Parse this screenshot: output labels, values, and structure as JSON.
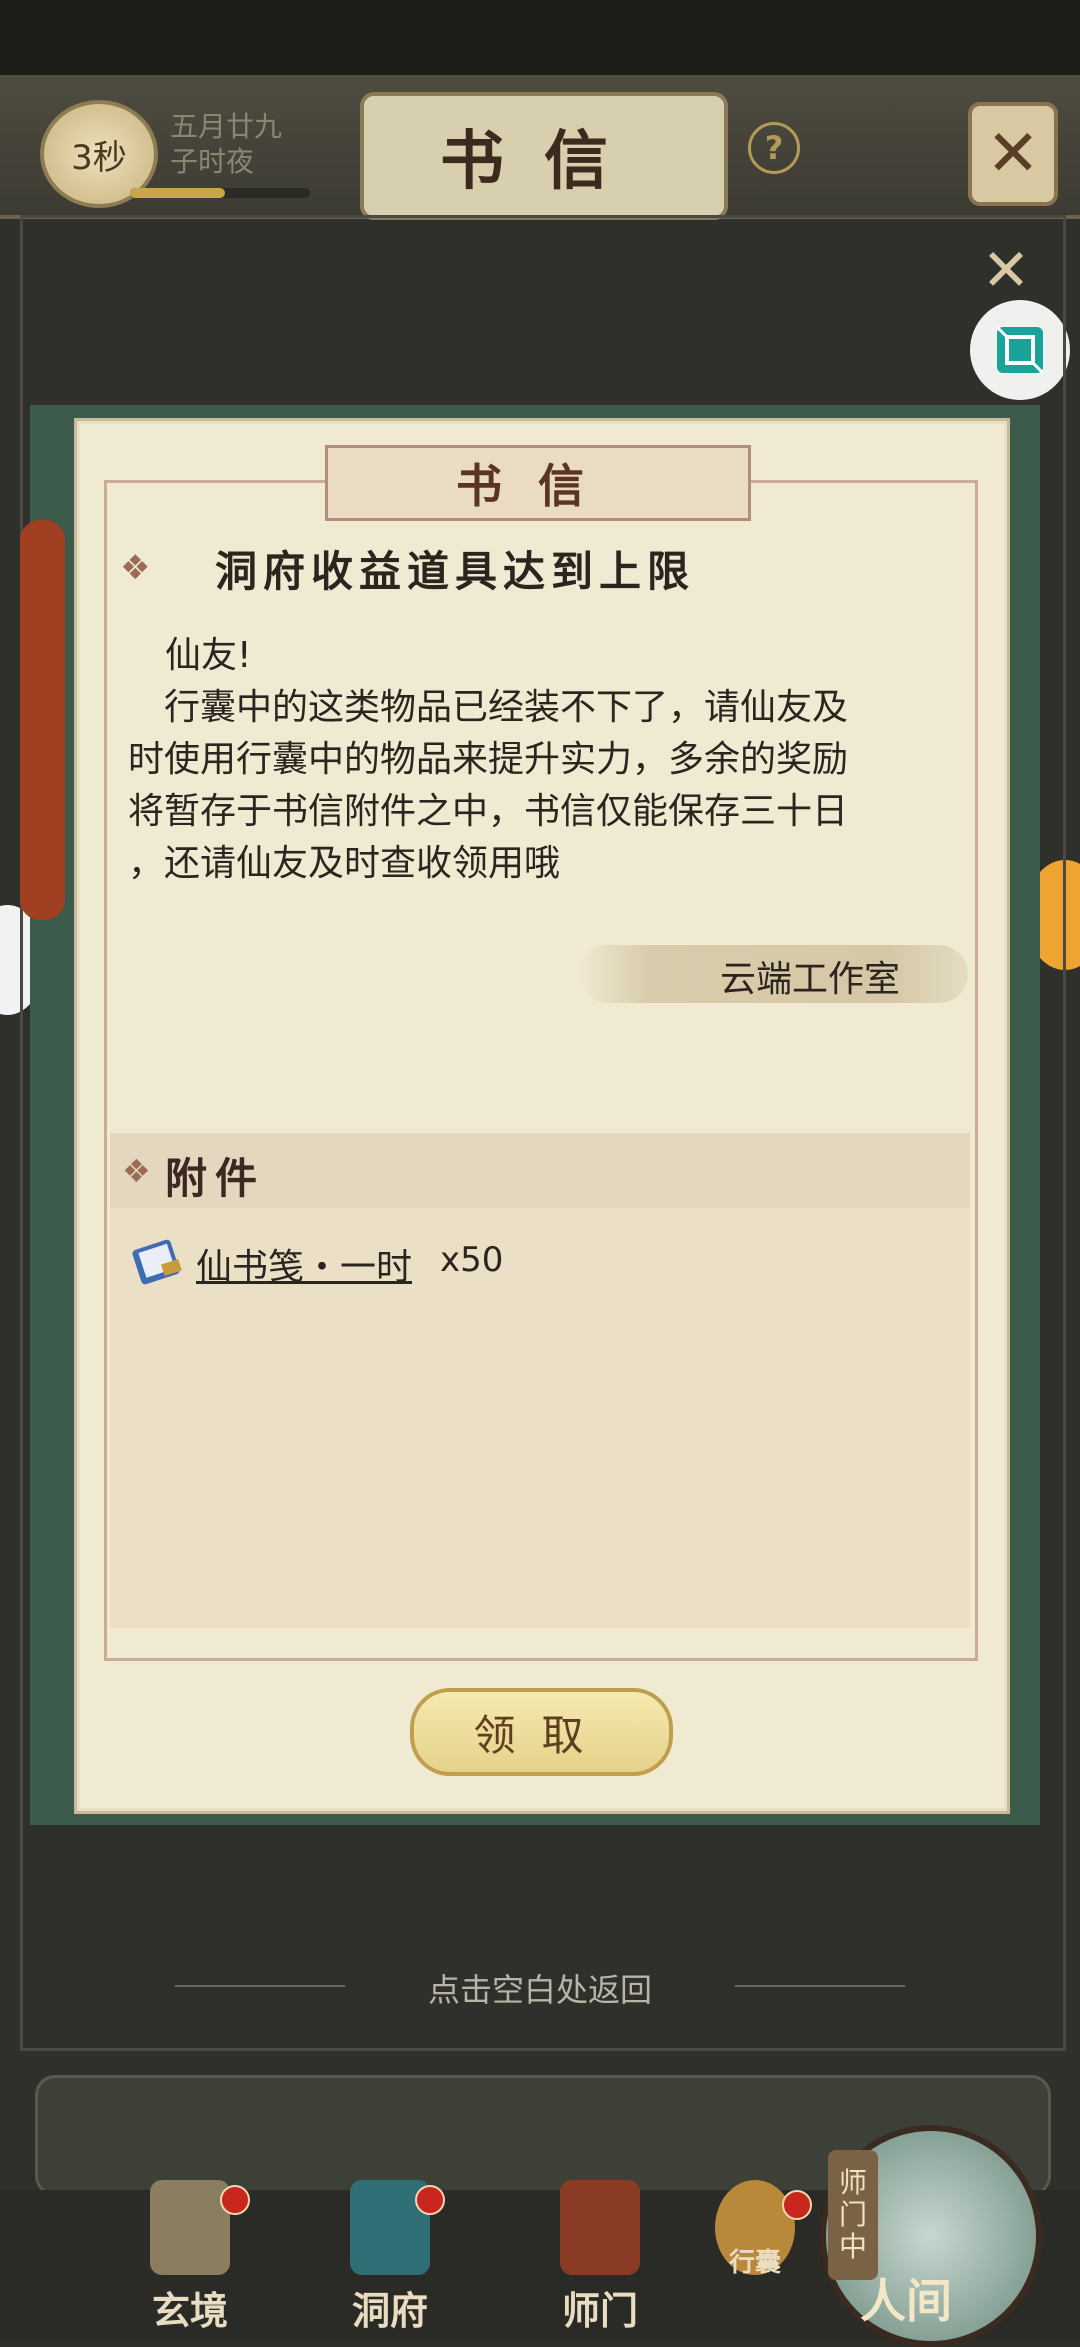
{
  "top_bar": {
    "timer": "3秒",
    "date_line1": "五月廿九",
    "date_line2": "子时夜",
    "title": "书信",
    "help_icon": "question-icon",
    "close_icon": "crossed-swords-icon"
  },
  "letter": {
    "banner": "书信",
    "subject": "洞府收益道具达到上限",
    "greeting": "仙友!",
    "body_lines": [
      "行囊中的这类物品已经装不下了，请仙友及",
      "时使用行囊中的物品来提升实力，多余的奖励",
      "将暂存于书信附件之中，书信仅能保存三十日",
      "，还请仙友及时查收领用哦"
    ],
    "signature": "云端工作室",
    "attachment_header": "附件",
    "attachment": {
      "name": "仙书笺・一时",
      "qty": "x50",
      "icon": "scroll-book-icon"
    },
    "claim_button": "领取"
  },
  "return_hint": "点击空白处返回",
  "nav": {
    "items": [
      {
        "label": "玄境",
        "icon": "scroll-icon",
        "badge": true
      },
      {
        "label": "洞府",
        "icon": "pavilion-icon",
        "badge": true
      },
      {
        "label": "师门",
        "icon": "banner-icon",
        "badge": false
      },
      {
        "label": "行囊",
        "icon": "pouch-icon",
        "badge": true
      }
    ],
    "sect_tag": [
      "师",
      "门",
      "中"
    ],
    "world": "人间"
  }
}
